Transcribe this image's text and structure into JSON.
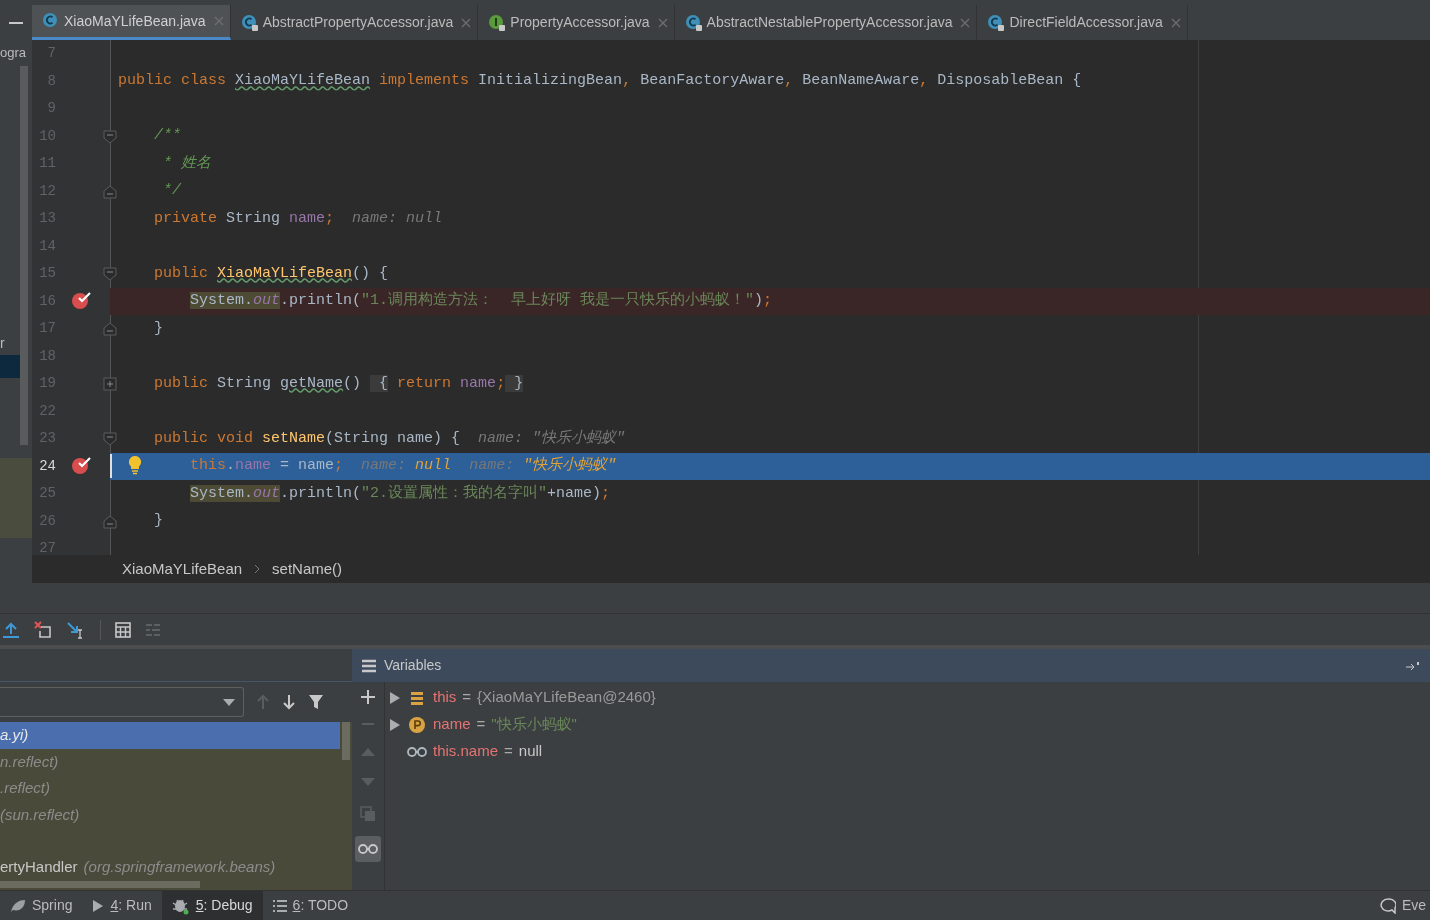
{
  "project_panel": {
    "items": [
      {
        "label": "ogra"
      },
      {
        "label": "r"
      }
    ]
  },
  "tabs": [
    {
      "label": "XiaoMaYLifeBean.java",
      "kind": "class",
      "selected": true
    },
    {
      "label": "AbstractPropertyAccessor.java",
      "kind": "locked_class",
      "selected": false
    },
    {
      "label": "PropertyAccessor.java",
      "kind": "locked_interface",
      "selected": false
    },
    {
      "label": "AbstractNestablePropertyAccessor.java",
      "kind": "locked_class",
      "selected": false
    },
    {
      "label": "DirectFieldAccessor.java",
      "kind": "locked_class",
      "selected": false
    }
  ],
  "editor": {
    "lines": [
      {
        "number": "7",
        "fold_open": false,
        "fold_close": false,
        "folded": false,
        "breakpoint": false,
        "current": false,
        "intention": false
      },
      {
        "number": "8",
        "fold_open": false,
        "fold_close": false,
        "folded": false,
        "breakpoint": false,
        "current": false,
        "intention": false,
        "tokens": [
          {
            "kind": "kw",
            "text": "public class "
          },
          {
            "kind": "typo",
            "text": "XiaoMaYLifeBean"
          },
          {
            "kind": "kw",
            "text": " implements "
          },
          {
            "kind": "plain",
            "text": "InitializingBean"
          },
          {
            "kind": "kw",
            "text": ", "
          },
          {
            "kind": "plain",
            "text": "BeanFactoryAware"
          },
          {
            "kind": "kw",
            "text": ", "
          },
          {
            "kind": "plain",
            "text": "BeanNameAware"
          },
          {
            "kind": "kw",
            "text": ", "
          },
          {
            "kind": "plain",
            "text": "DisposableBean {"
          }
        ]
      },
      {
        "number": "9",
        "fold_open": false,
        "fold_close": false,
        "folded": false,
        "breakpoint": false,
        "current": false,
        "intention": false
      },
      {
        "number": "10",
        "fold_open": true,
        "fold_close": false,
        "folded": false,
        "breakpoint": false,
        "current": false,
        "intention": false,
        "tokens": [
          {
            "kind": "doc",
            "text": "    /**"
          }
        ]
      },
      {
        "number": "11",
        "fold_open": false,
        "fold_close": false,
        "folded": false,
        "breakpoint": false,
        "current": false,
        "intention": false,
        "tokens": [
          {
            "kind": "doc",
            "text": "     * 姓名"
          }
        ]
      },
      {
        "number": "12",
        "fold_open": false,
        "fold_close": true,
        "folded": false,
        "breakpoint": false,
        "current": false,
        "intention": false,
        "tokens": [
          {
            "kind": "doc",
            "text": "     */"
          }
        ]
      },
      {
        "number": "13",
        "fold_open": false,
        "fold_close": false,
        "folded": false,
        "breakpoint": false,
        "current": false,
        "intention": false,
        "tokens": [
          {
            "kind": "kw",
            "text": "    private "
          },
          {
            "kind": "plain",
            "text": "String "
          },
          {
            "kind": "field",
            "text": "name"
          },
          {
            "kind": "kw",
            "text": ";"
          },
          {
            "kind": "hint",
            "text": "  name: null"
          }
        ]
      },
      {
        "number": "14",
        "fold_open": false,
        "fold_close": false,
        "folded": false,
        "breakpoint": false,
        "current": false,
        "intention": false
      },
      {
        "number": "15",
        "fold_open": true,
        "fold_close": false,
        "folded": false,
        "breakpoint": false,
        "current": false,
        "intention": false,
        "tokens": [
          {
            "kind": "kw",
            "text": "    public "
          },
          {
            "kind": "decl_typo",
            "text": "XiaoMaYLifeBean"
          },
          {
            "kind": "plain",
            "text": "() {"
          }
        ]
      },
      {
        "number": "16",
        "fold_open": false,
        "fold_close": false,
        "folded": false,
        "breakpoint": true,
        "current": false,
        "intention": false,
        "tokens": [
          {
            "kind": "sys",
            "text": "        System."
          },
          {
            "kind": "sys_static",
            "text": "out"
          },
          {
            "kind": "plain",
            "text": ".println("
          },
          {
            "kind": "string",
            "text": "\"1.调用构造方法：  早上好呀 我是一只快乐的小蚂蚁！\""
          },
          {
            "kind": "plain",
            "text": ")"
          },
          {
            "kind": "kw",
            "text": ";"
          }
        ]
      },
      {
        "number": "17",
        "fold_open": false,
        "fold_close": true,
        "folded": false,
        "breakpoint": false,
        "current": false,
        "intention": false,
        "tokens": [
          {
            "kind": "plain",
            "text": "    }"
          }
        ]
      },
      {
        "number": "18",
        "fold_open": false,
        "fold_close": false,
        "folded": false,
        "breakpoint": false,
        "current": false,
        "intention": false
      },
      {
        "number": "19",
        "fold_open": false,
        "fold_close": false,
        "folded": true,
        "breakpoint": false,
        "current": false,
        "intention": false,
        "tokens": [
          {
            "kind": "kw",
            "text": "    public "
          },
          {
            "kind": "plain",
            "text": "String "
          },
          {
            "kind": "typo",
            "text": "getName"
          },
          {
            "kind": "plain",
            "text": "() "
          },
          {
            "kind": "folded",
            "text": " {"
          },
          {
            "kind": "kw",
            "text": " return "
          },
          {
            "kind": "field",
            "text": "name"
          },
          {
            "kind": "kw",
            "text": ";"
          },
          {
            "kind": "folded",
            "text": " }"
          }
        ]
      },
      {
        "number": "22",
        "fold_open": false,
        "fold_close": false,
        "folded": false,
        "breakpoint": false,
        "current": false,
        "intention": false
      },
      {
        "number": "23",
        "fold_open": true,
        "fold_close": false,
        "folded": false,
        "breakpoint": false,
        "current": false,
        "intention": false,
        "tokens": [
          {
            "kind": "kw",
            "text": "    public void "
          },
          {
            "kind": "decl",
            "text": "setName"
          },
          {
            "kind": "plain",
            "text": "(String name) {"
          },
          {
            "kind": "hint",
            "text": "  name: \"快乐小蚂蚁\""
          }
        ]
      },
      {
        "number": "24",
        "fold_open": false,
        "fold_close": false,
        "folded": false,
        "breakpoint": true,
        "current": true,
        "intention": true,
        "tokens": [
          {
            "kind": "kw",
            "text": "        this"
          },
          {
            "kind": "plain",
            "text": "."
          },
          {
            "kind": "field",
            "text": "name"
          },
          {
            "kind": "plain",
            "text": " = name"
          },
          {
            "kind": "kw",
            "text": ";"
          },
          {
            "kind": "hint",
            "text": "  name: "
          },
          {
            "kind": "hint_value",
            "text": "null"
          },
          {
            "kind": "hint",
            "text": "  name: "
          },
          {
            "kind": "hint_value",
            "text": "\"快乐小蚂蚁\""
          }
        ]
      },
      {
        "number": "25",
        "fold_open": false,
        "fold_close": false,
        "folded": false,
        "breakpoint": false,
        "current": false,
        "intention": false,
        "tokens": [
          {
            "kind": "sys",
            "text": "        System."
          },
          {
            "kind": "sys_static",
            "text": "out"
          },
          {
            "kind": "plain",
            "text": ".println("
          },
          {
            "kind": "string",
            "text": "\"2.设置属性：我的名字叫\""
          },
          {
            "kind": "plain",
            "text": "+name)"
          },
          {
            "kind": "kw",
            "text": ";"
          }
        ]
      },
      {
        "number": "26",
        "fold_open": false,
        "fold_close": true,
        "folded": false,
        "breakpoint": false,
        "current": false,
        "intention": false,
        "tokens": [
          {
            "kind": "plain",
            "text": "    }"
          }
        ]
      },
      {
        "number": "27",
        "fold_open": false,
        "fold_close": false,
        "folded": false,
        "breakpoint": false,
        "current": false,
        "intention": false
      }
    ]
  },
  "breadcrumbs": [
    "XiaoMaYLifeBean",
    "setName()"
  ],
  "frames": [
    {
      "package": "a.yi)",
      "selected": true
    },
    {
      "package": "n.reflect)",
      "selected": false
    },
    {
      "package": ".reflect)",
      "selected": false
    },
    {
      "package": "(sun.reflect)",
      "selected": false
    },
    {
      "method": "ertyHandler",
      "package": "(org.springframework.beans)",
      "selected": false
    }
  ],
  "variables": {
    "title": "Variables",
    "items": [
      {
        "kind": "object",
        "name": "this",
        "operator": "=",
        "value": "{XiaoMaYLifeBean@2460}"
      },
      {
        "kind": "field",
        "name": "name",
        "operator": "=",
        "value": "\"快乐小蚂蚁\""
      },
      {
        "kind": "watch",
        "name": "this.name",
        "operator": "=",
        "value": "null"
      }
    ]
  },
  "tool_windows": [
    {
      "label": "Spring",
      "kind": "spring",
      "selected": false
    },
    {
      "key": "4",
      "label": ": Run",
      "kind": "run",
      "selected": false
    },
    {
      "key": "5",
      "label": ": Debug",
      "kind": "debug",
      "selected": true
    },
    {
      "key": "6",
      "label": ": TODO",
      "kind": "todo",
      "selected": false
    }
  ],
  "event_log": "Eve"
}
